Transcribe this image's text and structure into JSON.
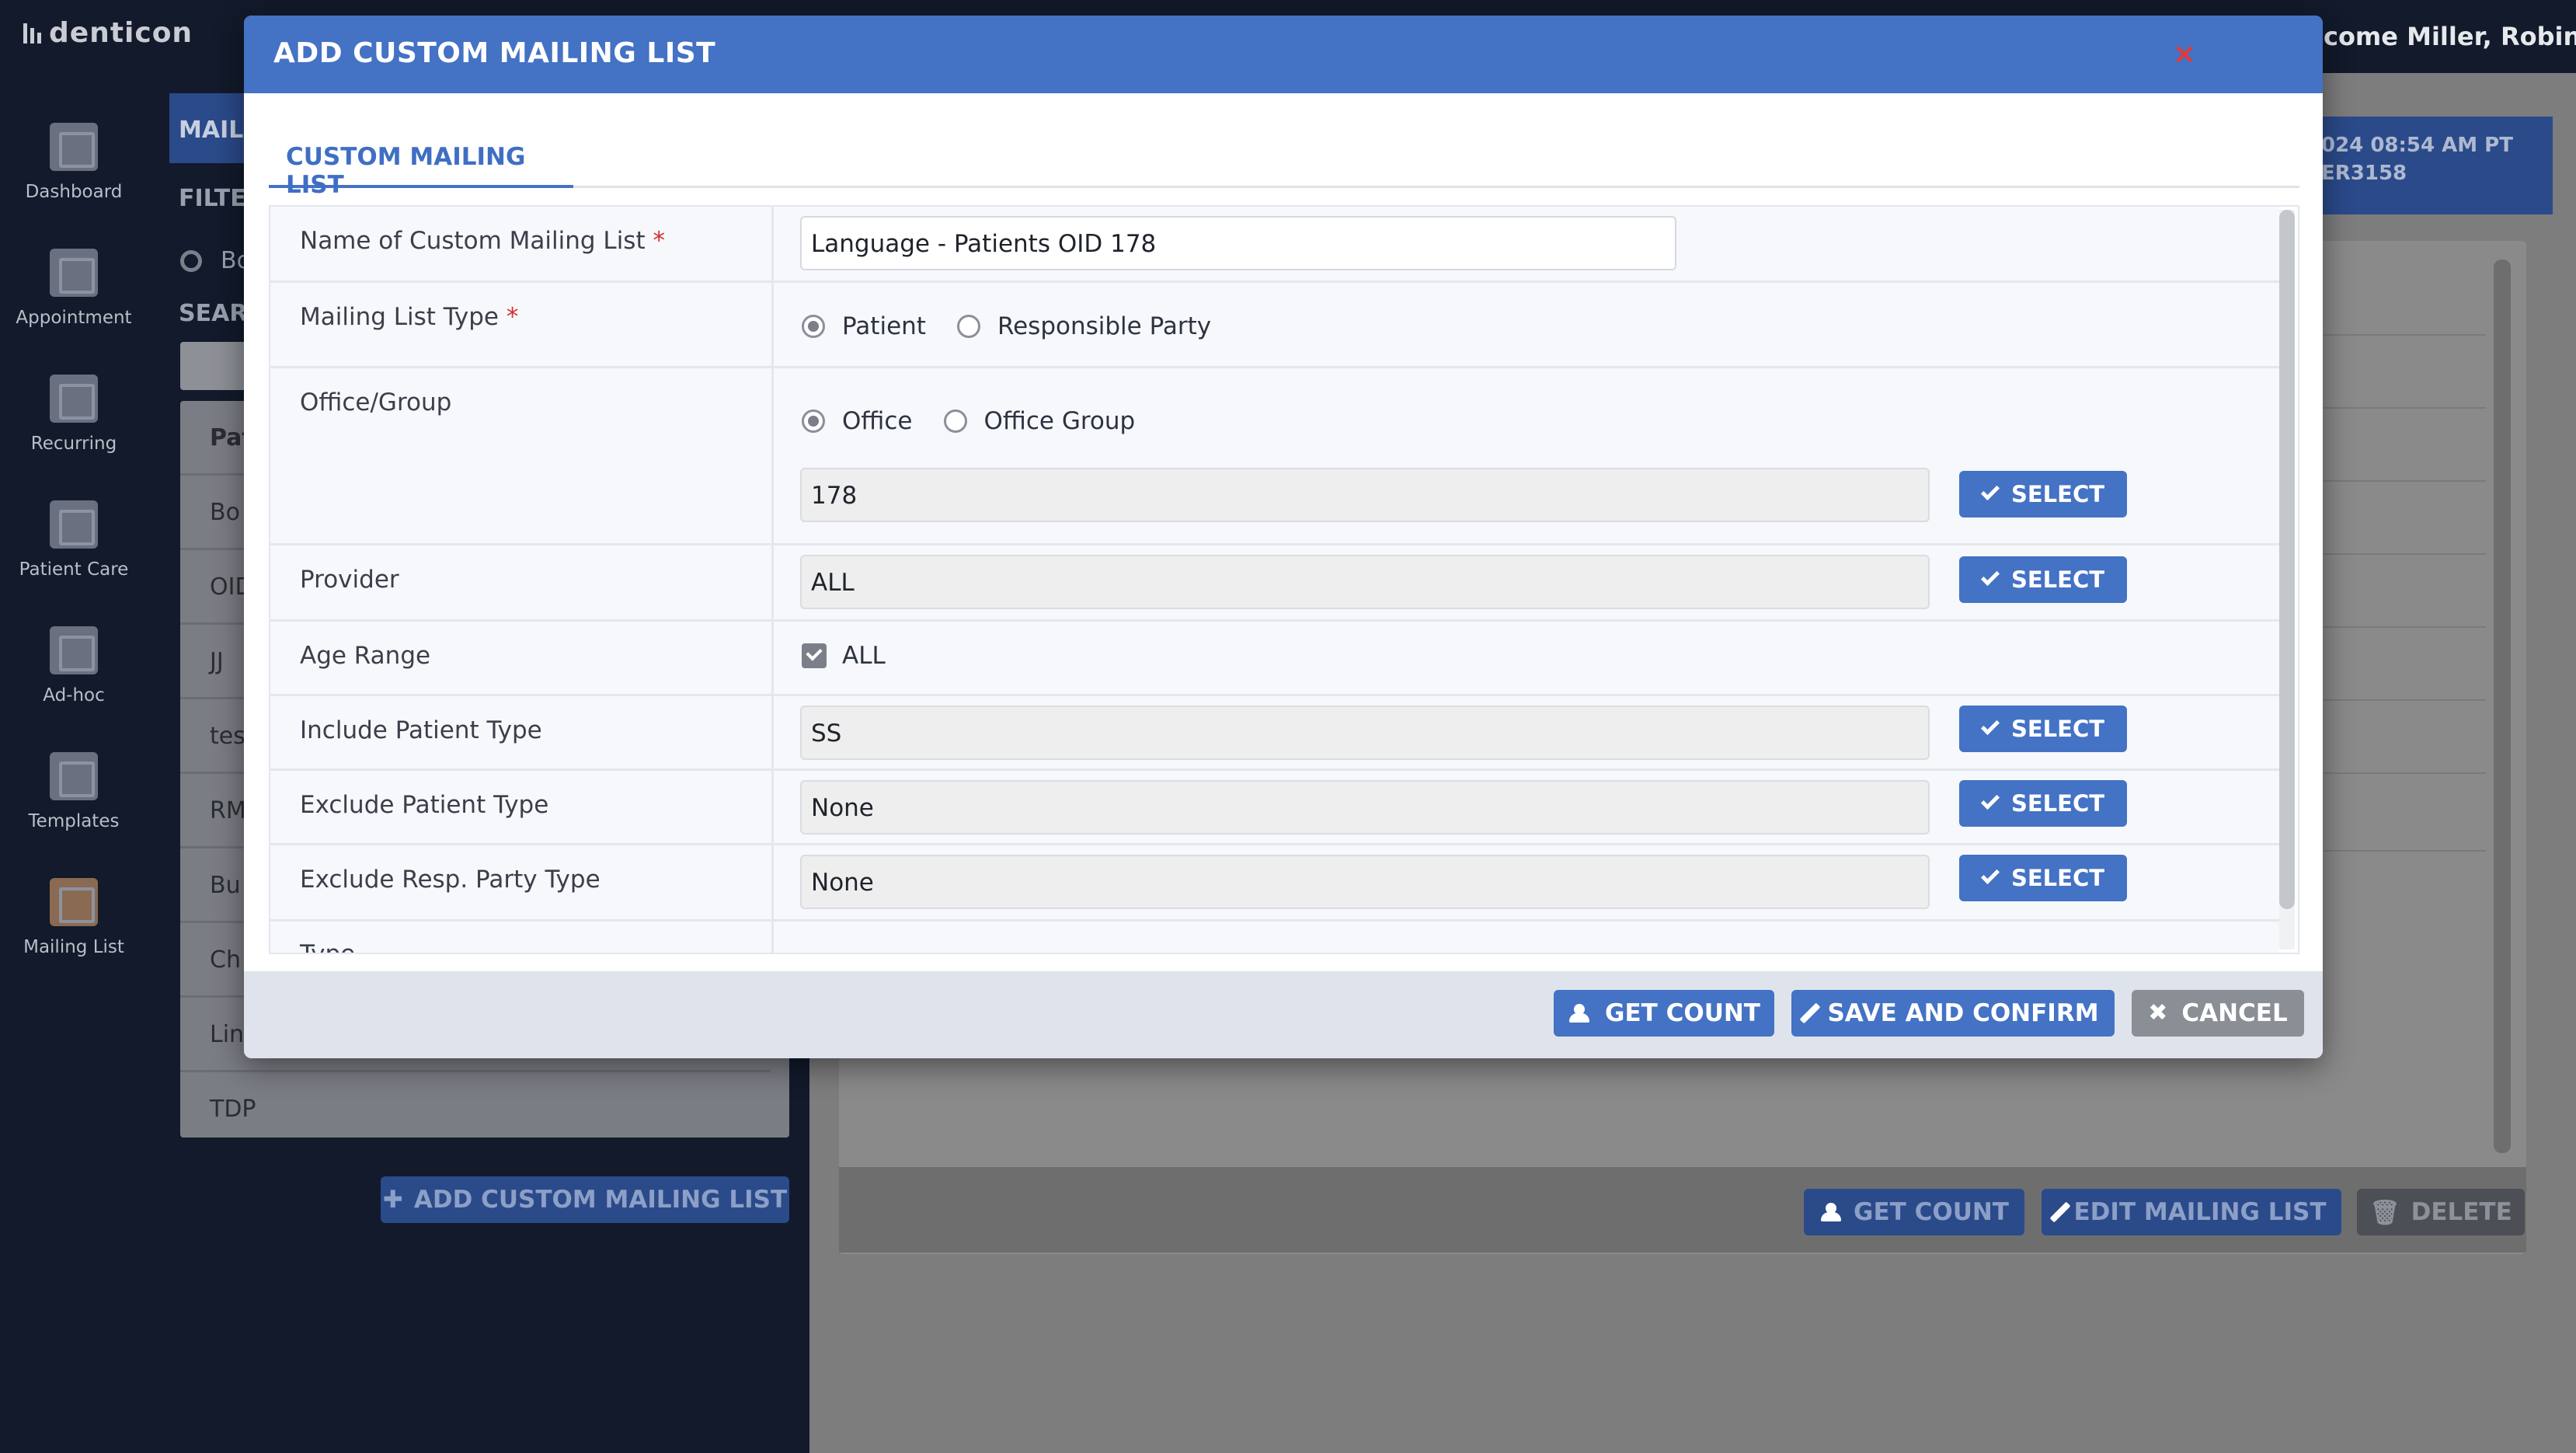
{
  "app": {
    "logo_text": "denticon",
    "welcome": "lcome Miller, Robin",
    "header_timestamp": "024 08:54 AM PT",
    "header_server": "ER3158"
  },
  "sidebar": {
    "items": [
      {
        "label": "Dashboard",
        "icon": "dashboard-icon"
      },
      {
        "label": "Appointment",
        "icon": "appointment-icon"
      },
      {
        "label": "Recurring",
        "icon": "recurring-icon"
      },
      {
        "label": "Patient Care",
        "icon": "patient-care-icon"
      },
      {
        "label": "Ad-hoc",
        "icon": "adhoc-icon"
      },
      {
        "label": "Templates",
        "icon": "templates-icon"
      },
      {
        "label": "Mailing List",
        "icon": "mailing-list-icon"
      }
    ]
  },
  "left_panel": {
    "tab_label": "MAIL",
    "filter_label": "FILTE",
    "radio_label": "Bo",
    "search_label": "SEAR",
    "list_header": "Pat",
    "rows": [
      "Bo",
      "OID",
      "JJ",
      "tes",
      "RM",
      "Bu",
      "Ch",
      "Lin",
      "TDP"
    ],
    "add_button": "ADD CUSTOM MAILING LIST"
  },
  "right_panel": {
    "get_count": "GET COUNT",
    "edit_mailing_list": "EDIT MAILING LIST",
    "delete": "DELETE"
  },
  "modal": {
    "title": "ADD CUSTOM MAILING LIST",
    "close_symbol": "×",
    "tab_label": "CUSTOM MAILING LIST",
    "fields": {
      "name_label": "Name of Custom Mailing List",
      "name_value": "Language - Patients OID 178",
      "type_label": "Mailing List Type",
      "type_options": [
        "Patient",
        "Responsible Party"
      ],
      "office_label": "Office/Group",
      "office_options": [
        "Office",
        "Office Group"
      ],
      "office_value": "178",
      "provider_label": "Provider",
      "provider_value": "ALL",
      "age_label": "Age Range",
      "age_all_label": "ALL",
      "include_type_label": "Include Patient Type",
      "include_type_value": "SS",
      "exclude_type_label": "Exclude Patient Type",
      "exclude_type_value": "None",
      "exclude_resp_label": "Exclude Resp. Party Type",
      "exclude_resp_value": "None",
      "partial_label": "Type"
    },
    "required_mark": "*",
    "select_label": "SELECT",
    "footer": {
      "get_count": "GET COUNT",
      "save_confirm": "SAVE AND CONFIRM",
      "cancel": "CANCEL"
    }
  },
  "colors": {
    "modal_header": "#4472c4",
    "primary_button": "#4472c4",
    "cancel_button": "#8a8e95",
    "required": "#d32f2f",
    "close_icon": "#e53935"
  }
}
